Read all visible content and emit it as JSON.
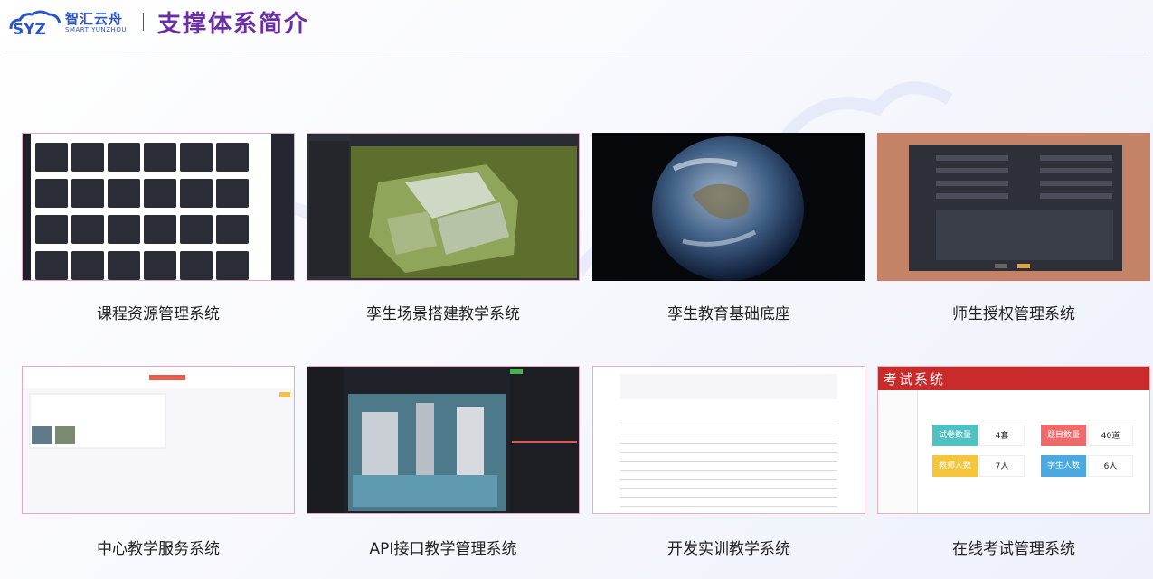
{
  "header": {
    "logo_cn": "智汇云舟",
    "logo_en": "SMART YUNZHOU",
    "title": "支撑体系简介"
  },
  "cards": [
    {
      "caption": "课程资源管理系统"
    },
    {
      "caption": "孪生场景搭建教学系统"
    },
    {
      "caption": "孪生教育基础底座"
    },
    {
      "caption": "师生授权管理系统"
    },
    {
      "caption": "中心教学服务系统"
    },
    {
      "caption": "API接口教学管理系统"
    },
    {
      "caption": "开发实训教学系统"
    },
    {
      "caption": "在线考试管理系统"
    }
  ],
  "exam_thumb": {
    "brand": "考试系统",
    "stats": [
      {
        "label": "试卷数量",
        "value": "4套",
        "color": "#4fc1c3"
      },
      {
        "label": "题目数量",
        "value": "40道",
        "color": "#ef6b6b"
      },
      {
        "label": "教师人数",
        "value": "7人",
        "color": "#f5c53c"
      },
      {
        "label": "学生人数",
        "value": "6人",
        "color": "#4aa9e0"
      }
    ]
  },
  "colors": {
    "title": "#6a2fa3",
    "logo": "#2a55c4",
    "exam_header": "#c92a2a"
  },
  "icons": [
    "cloud-logo-icon",
    "globe-icon"
  ]
}
